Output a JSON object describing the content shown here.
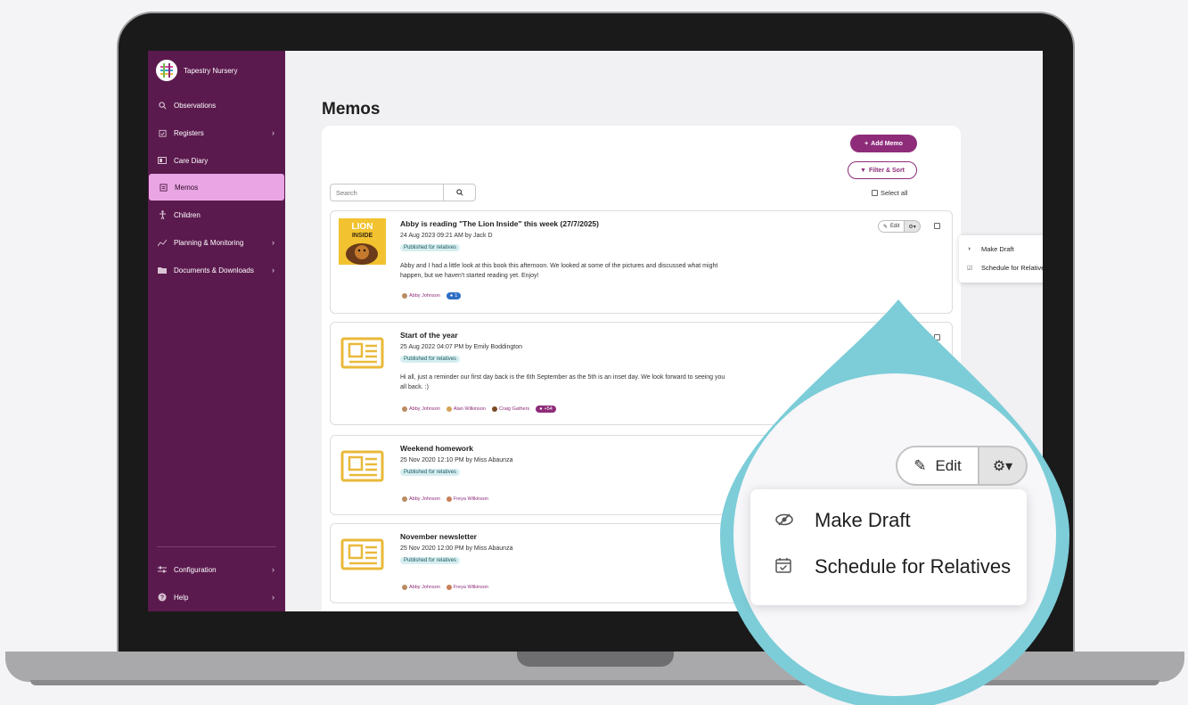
{
  "app": {
    "brand_name": "Tapestry Nursery"
  },
  "sidebar": {
    "items": [
      {
        "label": "Observations",
        "icon": "search-icon",
        "chevron": false,
        "active": false
      },
      {
        "label": "Registers",
        "icon": "register-icon",
        "chevron": true,
        "active": false
      },
      {
        "label": "Care Diary",
        "icon": "diary-icon",
        "chevron": false,
        "active": false
      },
      {
        "label": "Memos",
        "icon": "memo-icon",
        "chevron": false,
        "active": true
      },
      {
        "label": "Children",
        "icon": "child-icon",
        "chevron": false,
        "active": false
      },
      {
        "label": "Planning & Monitoring",
        "icon": "planning-icon",
        "chevron": true,
        "active": false
      },
      {
        "label": "Documents & Downloads",
        "icon": "folder-icon",
        "chevron": true,
        "active": false
      }
    ],
    "bottom_items": [
      {
        "label": "Configuration",
        "icon": "sliders-icon",
        "chevron": true
      },
      {
        "label": "Help",
        "icon": "help-icon",
        "chevron": true
      }
    ]
  },
  "main": {
    "title": "Memos",
    "add_memo_label": "Add Memo",
    "filter_sort_label": "Filter & Sort",
    "search_placeholder": "Search",
    "select_all_label": "Select all",
    "edit_label": "Edit"
  },
  "memos": [
    {
      "title": "Abby is reading \"The Lion Inside\" this week (27/7/2025)",
      "meta": "24 Aug 2023 09:21 AM by Jack D",
      "status": "Published for relatives",
      "body": "Abby and I had a little look at this book this afternoon. We looked at some of the pictures and discussed what might happen, but we haven't started reading yet. Enjoy!",
      "children": [
        "Abby Johnson"
      ],
      "comment_count": "1",
      "thumb_text": [
        "LION",
        "INSIDE"
      ]
    },
    {
      "title": "Start of the year",
      "meta": "25 Aug 2022 04:07 PM by Emily Boddington",
      "status": "Published for relatives",
      "body": "Hi all, just a reminder our first day back is the 6th September as the 5th is an inset day. We look forward to seeing you all back. :)",
      "children": [
        "Abby Johnson",
        "Alan Wilkinson",
        "Craig Gathers"
      ],
      "extra_count": "+54"
    },
    {
      "title": "Weekend homework",
      "meta": "25 Nov 2020 12:10 PM by Miss Abaunza",
      "status": "Published for relatives",
      "body": "",
      "children": [
        "Abby Johnson",
        "Freya Wilkinson"
      ]
    },
    {
      "title": "November newsletter",
      "meta": "25 Nov 2020 12:00 PM by Miss Abaunza",
      "status": "Published for relatives",
      "body": "",
      "children": [
        "Abby Johnson",
        "Freya Wilkinson"
      ]
    }
  ],
  "dropdown": {
    "items": [
      "Make Draft",
      "Schedule for Relatives"
    ]
  },
  "zoom": {
    "edit_label": "Edit",
    "items": [
      "Make Draft",
      "Schedule for Relatives"
    ]
  },
  "colors": {
    "sidebar_bg": "#5b1a4e",
    "active_item": "#eaa6e4",
    "accent": "#8e2c7a",
    "callout": "#7ccdd8"
  }
}
